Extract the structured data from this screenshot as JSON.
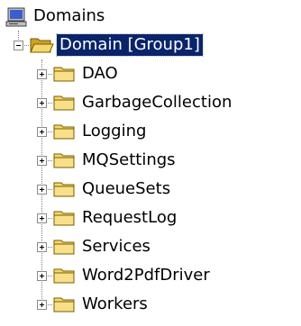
{
  "tree": {
    "root": {
      "label": "Domains",
      "icon": "computer-icon"
    },
    "domain": {
      "label": "Domain [Group1]",
      "icon": "open-folder-icon",
      "selected": true,
      "expanded": true
    },
    "children": [
      {
        "label": "DAO",
        "icon": "folder-icon",
        "expanded": false
      },
      {
        "label": "GarbageCollection",
        "icon": "folder-icon",
        "expanded": false
      },
      {
        "label": "Logging",
        "icon": "folder-icon",
        "expanded": false
      },
      {
        "label": "MQSettings",
        "icon": "folder-icon",
        "expanded": false
      },
      {
        "label": "QueueSets",
        "icon": "folder-icon",
        "expanded": false
      },
      {
        "label": "RequestLog",
        "icon": "folder-icon",
        "expanded": false
      },
      {
        "label": "Services",
        "icon": "folder-icon",
        "expanded": false
      },
      {
        "label": "Word2PdfDriver",
        "icon": "folder-icon",
        "expanded": false
      },
      {
        "label": "Workers",
        "icon": "folder-icon",
        "expanded": false
      }
    ]
  },
  "colors": {
    "selection_background": "#0a246a",
    "selection_text": "#ffffff",
    "folder_fill": "#f5d76e",
    "folder_dark": "#c9a227",
    "connector": "#808080"
  }
}
